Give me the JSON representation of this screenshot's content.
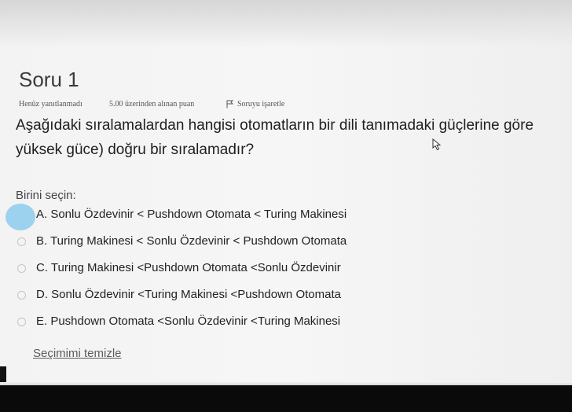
{
  "question": {
    "title": "Soru 1",
    "status": "Henüz yanıtlanmadı",
    "points": "5.00 üzerinden alınan puan",
    "flag_label": "Soruyu işaretle",
    "text_line1": "Aşağıdaki sıralamalardan hangisi otomatların bir dili tanımadaki güçlerine göre",
    "text_line2": "yüksek güce) doğru bir sıralamadır?"
  },
  "answer": {
    "prompt": "Birini seçin:",
    "options": [
      {
        "label": "A. Sonlu Özdevinir < Pushdown Otomata < Turing Makinesi"
      },
      {
        "label": "B. Turing Makinesi < Sonlu Özdevinir < Pushdown Otomata"
      },
      {
        "label": "C. Turing Makinesi <Pushdown Otomata <Sonlu Özdevinir"
      },
      {
        "label": "D. Sonlu Özdevinir <Turing Makinesi <Pushdown Otomata"
      },
      {
        "label": "E. Pushdown Otomata <Sonlu Özdevinir <Turing Makinesi"
      }
    ],
    "clear_label": "Seçimimi temizle"
  },
  "icons": {
    "flag": "flag-icon",
    "cursor": "mouse-cursor-icon",
    "radio": "radio-button-icon"
  },
  "colors": {
    "background": "#f3f3f3",
    "text": "#222222",
    "redaction": "#9cd2ee"
  }
}
